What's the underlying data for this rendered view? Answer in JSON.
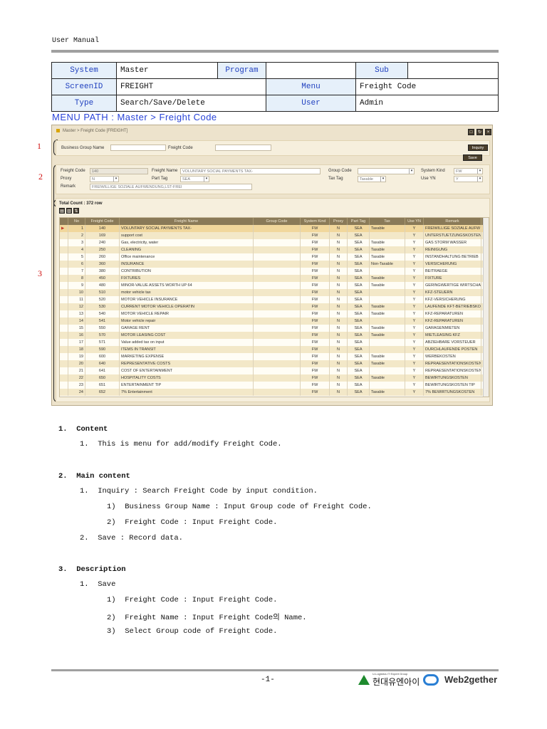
{
  "header": {
    "title": "User Manual"
  },
  "info": {
    "system_label": "System",
    "system": "Master",
    "program_label": "Program",
    "program": "",
    "sub_label": "Sub",
    "sub": "",
    "screenid_label": "ScreenID",
    "screenid": "FREIGHT",
    "menu_label": "Menu",
    "menu": "Freight Code",
    "type_label": "Type",
    "type": "Search/Save/Delete",
    "user_label": "User",
    "user": "Admin"
  },
  "menu_path": "MENU PATH :  Master  >  Freight Code",
  "screen": {
    "title": "Master > Freight Code [FREIGHT]",
    "markers": [
      "1",
      "2",
      "3"
    ],
    "search": {
      "bgn_label": "Business Group Name",
      "bgn_value": "",
      "fc_label": "Freight Code",
      "fc_value": "",
      "inquiry": "Inquiry",
      "save": "Save"
    },
    "form": {
      "fc_label": "Freight Code",
      "fc": "140",
      "fn_label": "Freight Name",
      "fn": "VOLUNTARY SOCIAL PAYMENTS TAX-",
      "gc_label": "Group Code",
      "gc": "",
      "sk_label": "System Kind",
      "sk": "FW",
      "proxy_label": "Proxy",
      "proxy": "N",
      "pt_label": "Part Tag",
      "pt": "SEA",
      "tt_label": "Tax Tag",
      "tt": "Taxable",
      "use_label": "Use YN",
      "use": "Y",
      "remark_label": "Remark",
      "remark": "FREIWILLIGE SOZIALE AUFWENDUNG,LST-FREI"
    },
    "total": "Total Count : 372 row",
    "columns": [
      "",
      "No",
      "Freight Code",
      "Freight Name",
      "Group Code",
      "System Kind",
      "Proxy",
      "Part Tag",
      "Tax",
      "Use YN",
      "Remark"
    ],
    "rows": [
      [
        "1",
        "140",
        "VOLUNTARY SOCIAL PAYMENTS TAX-",
        "",
        "FW",
        "N",
        "SEA",
        "Taxable",
        "Y",
        "FREIWILLIGE SOZIALE AUFW"
      ],
      [
        "2",
        "169",
        "support cost",
        "",
        "FW",
        "N",
        "SEA",
        "",
        "Y",
        "UNTERSTUETZUNGSKOSTEN"
      ],
      [
        "3",
        "240",
        "Gas, electricity, water",
        "",
        "FW",
        "N",
        "SEA",
        "Taxable",
        "Y",
        "GAS STORM WASSER"
      ],
      [
        "4",
        "250",
        "CLEANING",
        "",
        "FW",
        "N",
        "SEA",
        "Taxable",
        "Y",
        "REINIGUNG"
      ],
      [
        "5",
        "260",
        "Office maintenance",
        "",
        "FW",
        "N",
        "SEA",
        "Taxable",
        "Y",
        "INSTANDHALTUNG BETRIEB"
      ],
      [
        "6",
        "360",
        "INSURANCE",
        "",
        "FW",
        "N",
        "SEA",
        "Non-Taxable",
        "Y",
        "VERSICHERUNG"
      ],
      [
        "7",
        "380",
        "CONTRIBUTION",
        "",
        "FW",
        "N",
        "SEA",
        "",
        "Y",
        "BEITRAEGE"
      ],
      [
        "8",
        "450",
        "FIXTURES",
        "",
        "FW",
        "N",
        "SEA",
        "Taxable",
        "Y",
        "FIXTURE"
      ],
      [
        "9",
        "480",
        "MINOR-VALUE ASSETS WORTH UP 64",
        "",
        "FW",
        "N",
        "SEA",
        "Taxable",
        "Y",
        "GERINGWERTIGE WIRTSCHA"
      ],
      [
        "10",
        "510",
        "motor vehicle tax",
        "",
        "FW",
        "N",
        "SEA",
        "",
        "Y",
        "KFZ-STEUERN"
      ],
      [
        "11",
        "520",
        "MOTOR VEHICLE INSURANCE",
        "",
        "FW",
        "N",
        "SEA",
        "",
        "Y",
        "KFZ-VERSICHERUNG"
      ],
      [
        "12",
        "530",
        "CURRENT MOTOR VEHICLE OPERATIN",
        "",
        "FW",
        "N",
        "SEA",
        "Taxable",
        "Y",
        "LAUFENDE KFT-BETRIEBSKO"
      ],
      [
        "13",
        "540",
        "MOTOR VEHICLE REPAIR",
        "",
        "FW",
        "N",
        "SEA",
        "Taxable",
        "Y",
        "KFZ-REPARATUREN"
      ],
      [
        "14",
        "541",
        "Motor vehicle repair",
        "",
        "FW",
        "N",
        "SEA",
        "",
        "Y",
        "KFZ-REPARATUREN"
      ],
      [
        "15",
        "550",
        "GARAGE RENT",
        "",
        "FW",
        "N",
        "SEA",
        "Taxable",
        "Y",
        "GARAGENMIETEN"
      ],
      [
        "16",
        "570",
        "MOTOR LEASING COST",
        "",
        "FW",
        "N",
        "SEA",
        "Taxable",
        "Y",
        "MIETLEASING KFZ"
      ],
      [
        "17",
        "571",
        "Value added tax on input",
        "",
        "FW",
        "N",
        "SEA",
        "",
        "Y",
        "ABZIEHBARE VORSTEUER"
      ],
      [
        "18",
        "590",
        "ITEMS IN TRANSIT",
        "",
        "FW",
        "N",
        "SEA",
        "",
        "Y",
        "DURCHLAUFENDE POSTEN"
      ],
      [
        "19",
        "600",
        "MARKETING EXPENSE",
        "",
        "FW",
        "N",
        "SEA",
        "Taxable",
        "Y",
        "WERBEKOSTEN"
      ],
      [
        "20",
        "640",
        "REPRESENTATIVE COSTS",
        "",
        "FW",
        "N",
        "SEA",
        "Taxable",
        "Y",
        "REPRAESENTATIONSKOSTEN"
      ],
      [
        "21",
        "641",
        "COST OF ENTERTAINMENT",
        "",
        "FW",
        "N",
        "SEA",
        "",
        "Y",
        "REPRAESENTATIONSKOSTEN"
      ],
      [
        "22",
        "650",
        "HOSPITALITY COSTS",
        "",
        "FW",
        "N",
        "SEA",
        "Taxable",
        "Y",
        "BEWIRTUNGSKOSTEN"
      ],
      [
        "23",
        "651",
        "ENTERTAINMENT TIP",
        "",
        "FW",
        "N",
        "SEA",
        "",
        "Y",
        "BEWIRTUNGSKOSTEN TIP"
      ],
      [
        "24",
        "652",
        "7% Entertainment",
        "",
        "FW",
        "N",
        "SEA",
        "Taxable",
        "Y",
        "7% BEWIRTUNGSKOSTEN"
      ]
    ]
  },
  "doc": [
    {
      "text": "1.  Content",
      "bold": true
    },
    {
      "text": "1.  This is menu for add/modify Freight Code."
    },
    {
      "text": "2.  Main content",
      "bold": true
    },
    {
      "text": "1.  Inquiry : Search Freight Code by input condition."
    },
    {
      "text": "1)  Business Group Name : Input Group code of Freight Code."
    },
    {
      "text": "2)  Freight Code : Input Freight Code."
    },
    {
      "text": "2.  Save : Record data."
    },
    {
      "text": "3.  Description",
      "bold": true
    },
    {
      "text": "1.  Save"
    },
    {
      "text": "1)  Freight Code : Input Freight Code."
    },
    {
      "text": "2)  Freight Name : Input Freight Code의 Name."
    },
    {
      "text": "3)  Select Group code of Freight Code."
    }
  ],
  "footer": {
    "page": "-1-",
    "logo1_tag": "U-Logistics IT Expert Group",
    "logo1": "현대유엔아이",
    "logo2": "Web2gether"
  }
}
